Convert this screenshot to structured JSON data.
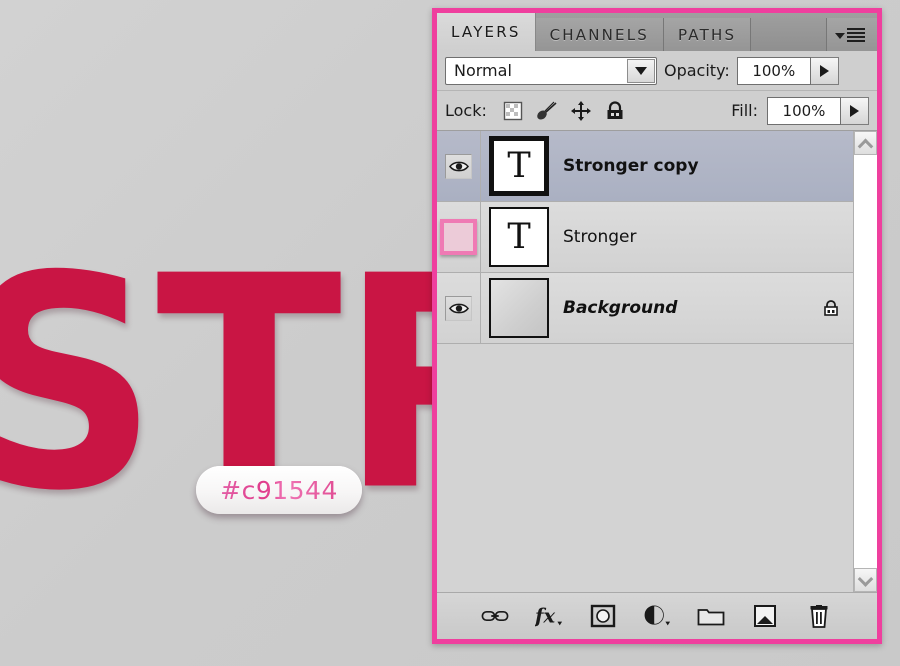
{
  "canvas": {
    "artwork_text": "STR",
    "artwork_color": "#c91544",
    "background_color": "#cccccc",
    "color_badge": {
      "label": "#c91544",
      "text_color": "#e0398a"
    }
  },
  "panel": {
    "highlight_border_color": "#ef3f9e",
    "tabs": [
      {
        "label": "LAYERS",
        "active": true
      },
      {
        "label": "CHANNELS",
        "active": false
      },
      {
        "label": "PATHS",
        "active": false
      }
    ],
    "menu_icon": "panel-menu-icon",
    "blend_mode": {
      "value": "Normal",
      "dropdown_icon": "chevron-down-icon"
    },
    "opacity": {
      "label": "Opacity:",
      "value": "100%",
      "stepper_icon": "arrow-right-icon"
    },
    "fill": {
      "label": "Fill:",
      "value": "100%",
      "stepper_icon": "arrow-right-icon"
    },
    "lock": {
      "label": "Lock:",
      "icons": [
        "lock-transparent-pixels-icon",
        "lock-image-pixels-icon",
        "lock-position-icon",
        "lock-all-icon"
      ]
    },
    "layers": [
      {
        "name": "Stronger copy",
        "visible": true,
        "selected": true,
        "thumb_glyph": "T",
        "thumb_type": "text",
        "locked": false,
        "style": "bold",
        "visibility_icon": "eye-icon"
      },
      {
        "name": "Stronger",
        "visible": false,
        "selected": false,
        "thumb_glyph": "T",
        "thumb_type": "text",
        "locked": false,
        "style": "normal",
        "visibility_icon": "eye-off-empty-icon",
        "annotation": "visibility-toggle-highlight"
      },
      {
        "name": "Background",
        "visible": true,
        "selected": false,
        "thumb_glyph": "",
        "thumb_type": "image",
        "locked": true,
        "style": "italic",
        "visibility_icon": "eye-icon",
        "lock_icon": "padlock-icon"
      }
    ],
    "scrollbar": {
      "up_icon": "chevron-up-icon",
      "down_icon": "chevron-down-icon"
    },
    "toolbar_buttons": [
      "link-layers-icon",
      "layer-style-fx-icon",
      "add-layer-mask-icon",
      "new-adjustment-layer-icon",
      "new-group-folder-icon",
      "new-layer-icon",
      "delete-layer-trash-icon"
    ]
  }
}
